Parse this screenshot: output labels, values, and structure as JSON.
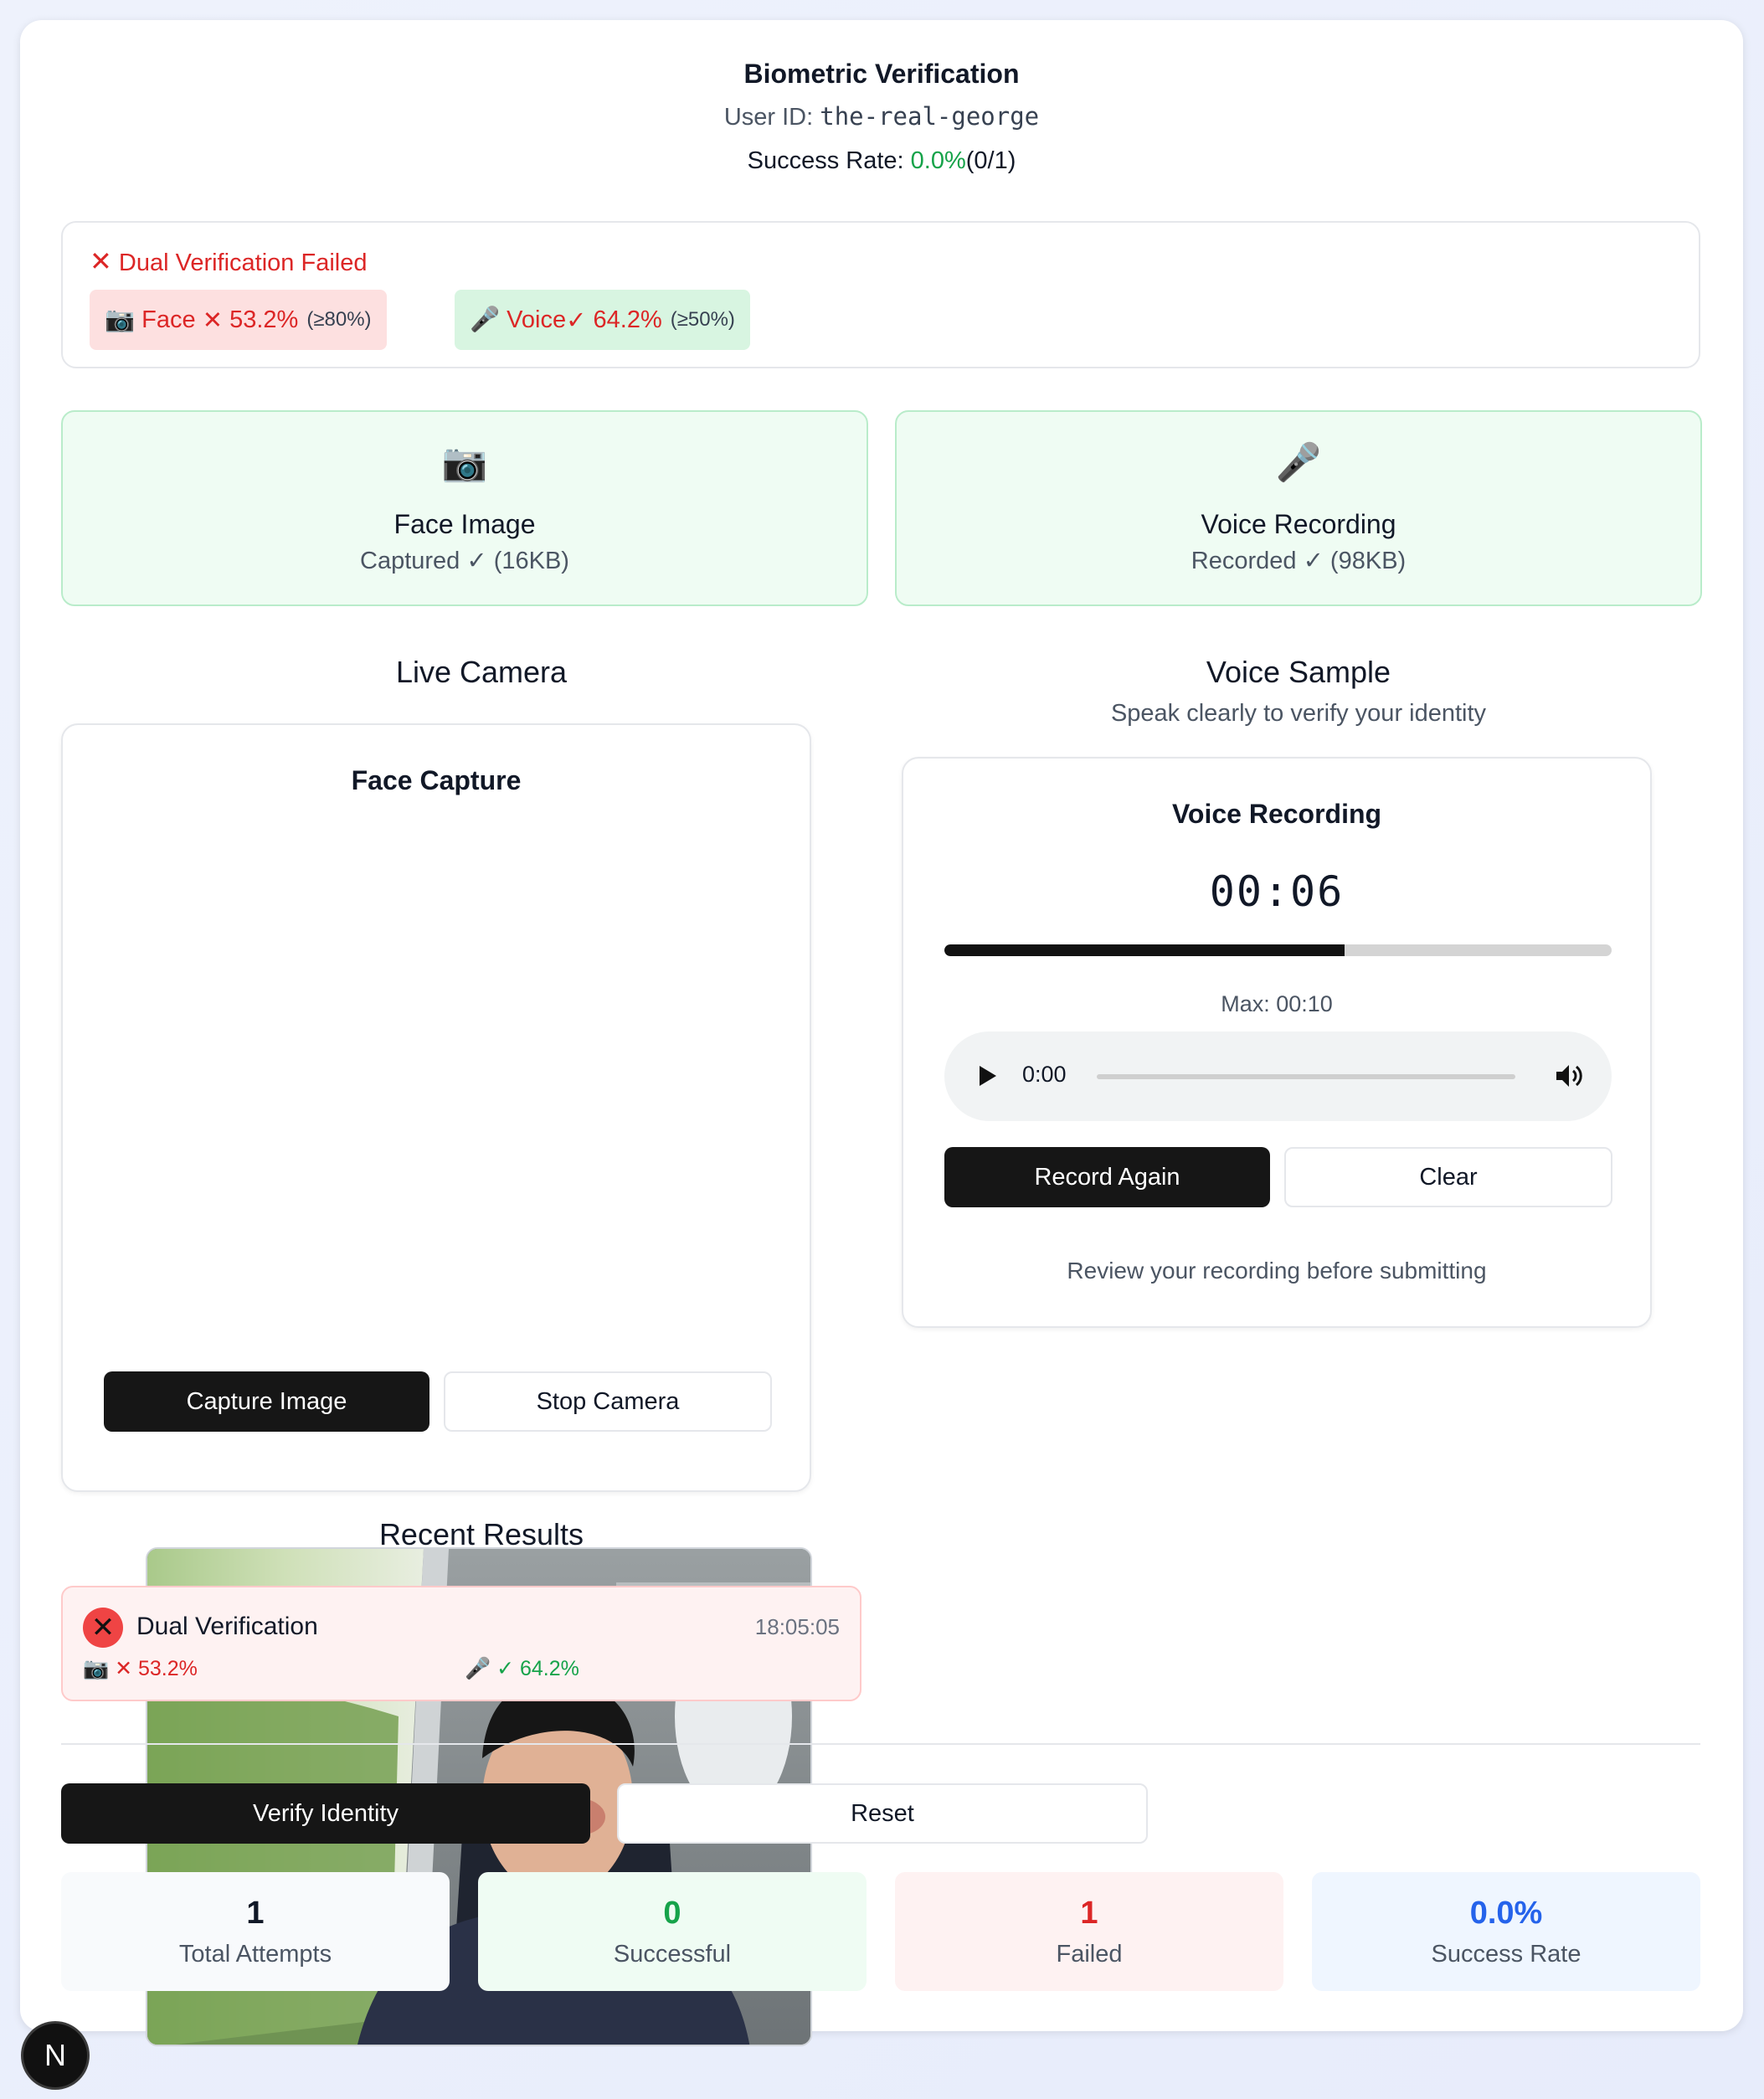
{
  "header": {
    "title": "Biometric Verification",
    "user_id_label": "User ID: ",
    "user_id": "the-real-george",
    "success_rate_label": "Success Rate: ",
    "success_rate_value": "0.0%",
    "success_rate_count": "(0/1)"
  },
  "verification_result": {
    "status_icon": "✕",
    "status_text": "Dual Verification Failed",
    "face": {
      "icon": "📷",
      "label": "Face",
      "mark": "✕",
      "score": "53.2%",
      "threshold": "(≥80%)"
    },
    "voice": {
      "icon": "🎤",
      "label": "Voice",
      "mark": "✓",
      "score": "64.2%",
      "threshold": "(≥50%)"
    }
  },
  "status_cards": {
    "face": {
      "icon": "📷",
      "title": "Face Image",
      "subtitle": "Captured ✓ (16KB)"
    },
    "voice": {
      "icon": "🎤",
      "title": "Voice Recording",
      "subtitle": "Recorded ✓ (98KB)"
    }
  },
  "camera_section": {
    "heading": "Live Camera",
    "panel_title": "Face Capture",
    "capture_button": "Capture Image",
    "stop_button": "Stop Camera"
  },
  "voice_section": {
    "heading": "Voice Sample",
    "subheading": "Speak clearly to verify your identity",
    "panel_title": "Voice Recording",
    "timer": "00:06",
    "progress_fraction": 0.6,
    "max_label": "Max: 00:10",
    "audio_time": "0:00",
    "record_again_button": "Record Again",
    "clear_button": "Clear",
    "hint": "Review your recording before submitting"
  },
  "recent_results": {
    "heading": "Recent Results",
    "items": [
      {
        "title": "Dual Verification",
        "time": "18:05:05",
        "face": "📷 ✕ 53.2%",
        "voice_icon": "🎤",
        "voice": "✓ 64.2%"
      }
    ]
  },
  "actions": {
    "verify_button": "Verify Identity",
    "reset_button": "Reset"
  },
  "stats": [
    {
      "value": "1",
      "label": "Total Attempts"
    },
    {
      "value": "0",
      "label": "Successful"
    },
    {
      "value": "1",
      "label": "Failed"
    },
    {
      "value": "0.0%",
      "label": "Success Rate"
    }
  ],
  "dev_badge": "N",
  "colors": {
    "success": "#16a34a",
    "danger": "#dc2626",
    "accent_blue": "#2563eb",
    "button_dark": "#161616"
  }
}
